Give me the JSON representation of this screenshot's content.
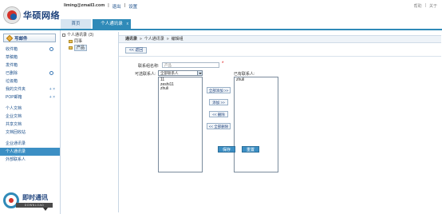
{
  "header": {
    "logo_text": "华硕网络",
    "email": "liming@zmail3.com",
    "logout": "退出",
    "settings": "设置",
    "help": "帮助",
    "about": "关于",
    "tabs": [
      {
        "label": "首页"
      },
      {
        "label": "个人通讯录",
        "close": "x"
      }
    ]
  },
  "sidebar": {
    "write_label": "写邮件",
    "items": [
      {
        "label": "收件箱"
      },
      {
        "label": "草稿箱"
      },
      {
        "label": "发件箱"
      },
      {
        "label": "已删除"
      },
      {
        "label": "垃圾箱"
      },
      {
        "label": "我的文件夹",
        "ops": "+ ×"
      },
      {
        "label": "POP邮箱",
        "ops": "+ ×"
      },
      {
        "label": "个人文档"
      },
      {
        "label": "企业文档"
      },
      {
        "label": "共享文档"
      },
      {
        "label": "文档回收站"
      },
      {
        "label": "企业通讯录"
      },
      {
        "label": "个人通讯录"
      },
      {
        "label": "外部联系人"
      }
    ],
    "im_label": "即时通讯",
    "im_download": "DOWNLOAD"
  },
  "tree": {
    "root": "个人通讯录",
    "root_count": "(3)",
    "children": [
      "同事",
      "产品"
    ]
  },
  "main": {
    "crumb_root": "通讯录",
    "crumb_sep1": "»",
    "crumb_mid": "个人通讯录",
    "crumb_sep2": "»",
    "crumb_end": "编辑组",
    "back": "<< 返回",
    "name_label": "联系组名称:",
    "name_value": "产品",
    "available_label": "可选联系人:",
    "select_value": "全部联系人",
    "selected_label": "已有联系人:",
    "available_list": [
      "11",
      "zeshi11",
      "zhuli"
    ],
    "selected_list": [
      "zhuli"
    ],
    "add_all": "全部添加 >>",
    "add": "添加 >>",
    "remove": "<< 删除",
    "remove_all": "<< 全部删除",
    "save": "保存",
    "reset": "重置"
  }
}
